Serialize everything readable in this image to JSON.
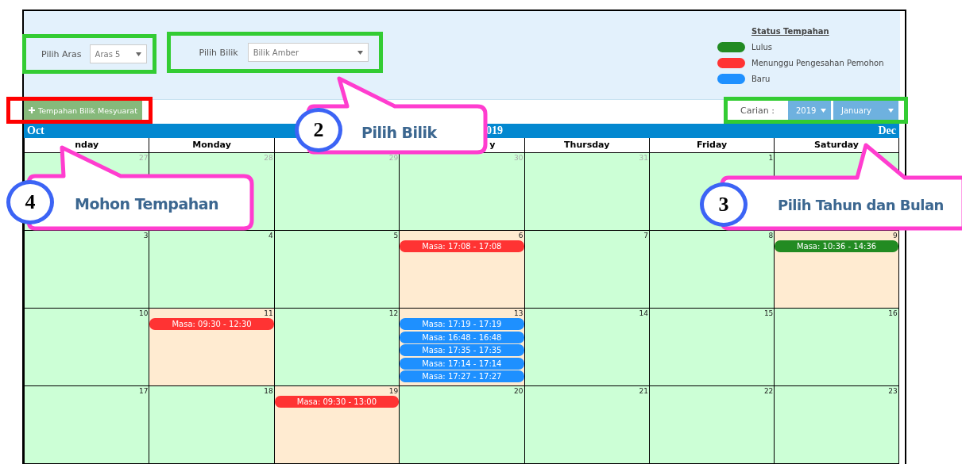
{
  "filters": [
    {
      "label": "Pilih Aras",
      "value": "Aras 5"
    },
    {
      "label": "Pilih Bilik",
      "value": "Bilik Amber"
    }
  ],
  "legend": {
    "title": "Status Tempahan",
    "items": [
      {
        "label": "Lulus",
        "color": "#228b22"
      },
      {
        "label": "Menunggu Pengesahan Pemohon",
        "color": "#ff3333"
      },
      {
        "label": "Baru",
        "color": "#1e90ff"
      }
    ]
  },
  "add_button": {
    "label": "Tempahan Bilik Mesyuarat"
  },
  "search": {
    "label": "Carian :",
    "year": "2019",
    "month": "January"
  },
  "calendar": {
    "prev": "Oct",
    "title": "019",
    "next": "Dec",
    "day_headers": [
      {
        "label": "nday"
      },
      {
        "label": "Monday"
      },
      {
        "kind": "covered"
      },
      {
        "label": "y"
      },
      {
        "label": "Thursday"
      },
      {
        "label": "Friday"
      },
      {
        "label": "Saturday"
      }
    ],
    "weeks": [
      [
        {
          "day": "27",
          "other_month": true,
          "booked": false
        },
        {
          "day": "28",
          "other_month": true,
          "booked": false
        },
        {
          "day": "29",
          "other_month": true,
          "booked": false
        },
        {
          "day": "30",
          "other_month": true,
          "booked": false
        },
        {
          "day": "31",
          "other_month": true,
          "booked": false
        },
        {
          "day": "1",
          "other_month": false,
          "booked": false
        },
        {
          "booked": false
        }
      ],
      [
        {
          "day": "3",
          "other_month": false,
          "booked": false
        },
        {
          "day": "4",
          "other_month": false,
          "booked": false
        },
        {
          "day": "5",
          "other_month": false,
          "booked": false
        },
        {
          "day": "6",
          "other_month": false,
          "booked": true,
          "events": [
            {
              "text": "Masa: 17:08 - 17:08",
              "color": "#ff3333"
            }
          ]
        },
        {
          "day": "7",
          "other_month": false,
          "booked": false
        },
        {
          "day": "8",
          "other_month": false,
          "booked": false
        },
        {
          "day": "9",
          "other_month": false,
          "booked": true,
          "events": [
            {
              "text": "Masa: 10:36 - 14:36",
              "color": "#228b22"
            }
          ]
        }
      ],
      [
        {
          "day": "10",
          "other_month": false,
          "booked": false
        },
        {
          "day": "11",
          "other_month": false,
          "booked": true,
          "events": [
            {
              "text": "Masa: 09:30 - 12:30",
              "color": "#ff3333"
            }
          ]
        },
        {
          "day": "12",
          "other_month": false,
          "booked": false
        },
        {
          "day": "13",
          "other_month": false,
          "booked": true,
          "events": [
            {
              "text": "Masa: 17:19 - 17:19",
              "color": "#1e90ff"
            },
            {
              "text": "Masa: 16:48 - 16:48",
              "color": "#1e90ff"
            },
            {
              "text": "Masa: 17:35 - 17:35",
              "color": "#1e90ff"
            },
            {
              "text": "Masa: 17:14 - 17:14",
              "color": "#1e90ff"
            },
            {
              "text": "Masa: 17:27 - 17:27",
              "color": "#1e90ff"
            }
          ]
        },
        {
          "day": "14",
          "other_month": false,
          "booked": false
        },
        {
          "day": "15",
          "other_month": false,
          "booked": false
        },
        {
          "day": "16",
          "other_month": false,
          "booked": false
        }
      ],
      [
        {
          "day": "17",
          "other_month": false,
          "booked": false
        },
        {
          "day": "18",
          "other_month": false,
          "booked": false
        },
        {
          "day": "19",
          "other_month": false,
          "booked": true,
          "events": [
            {
              "text": "Masa: 09:30 - 13:00",
              "color": "#ff3333"
            }
          ]
        },
        {
          "day": "20",
          "other_month": false,
          "booked": false
        },
        {
          "day": "21",
          "other_month": false,
          "booked": false
        },
        {
          "day": "22",
          "other_month": false,
          "booked": false
        },
        {
          "day": "23",
          "other_month": false,
          "booked": false
        }
      ]
    ]
  },
  "frames": [
    {
      "color": "#33cc33"
    },
    {
      "color": "#33cc33"
    },
    {
      "color": "#33cc33"
    },
    {
      "color": "#ff0000"
    }
  ],
  "callouts": [
    {
      "number": "2",
      "text": "Pilih Bilik"
    },
    {
      "number": "4",
      "text": "Mohon Tempahan"
    },
    {
      "number": "3",
      "text": "Pilih Tahun dan Bulan"
    }
  ]
}
